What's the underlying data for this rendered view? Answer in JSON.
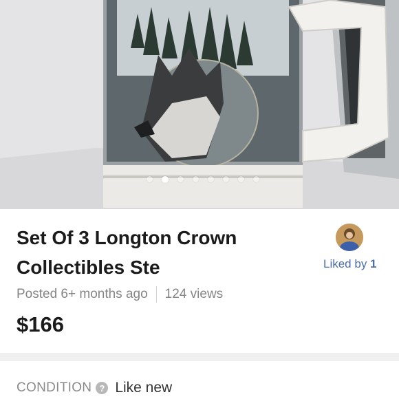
{
  "listing": {
    "title": "Set Of 3 Longton Crown Collectibles Ste",
    "posted": "Posted 6+ months ago",
    "views": "124 views",
    "price": "$166",
    "liked_prefix": "Liked by ",
    "liked_count": "1"
  },
  "gallery": {
    "image_count": 8,
    "active_index": 1
  },
  "condition": {
    "label": "CONDITION",
    "help_glyph": "?",
    "value": "Like new"
  },
  "icons": {
    "help": "question-circle-icon",
    "avatar": "seller-avatar"
  },
  "colors": {
    "link": "#4a6ea8",
    "title": "#1b1b1b",
    "muted": "#858585",
    "band": "#f0f0f0"
  }
}
